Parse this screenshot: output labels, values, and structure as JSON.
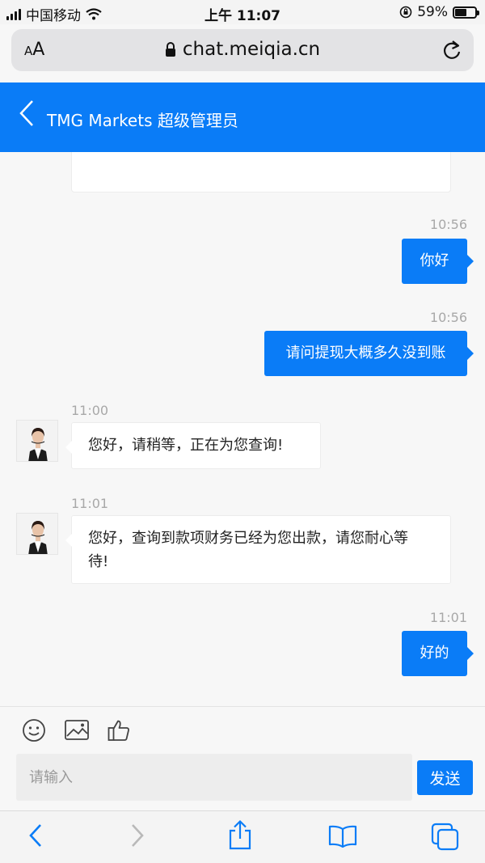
{
  "status_bar": {
    "carrier": "中国移动",
    "time": "上午 11:07",
    "battery_percent": "59%",
    "battery_level": 0.59
  },
  "browser": {
    "text_size_label_small": "A",
    "text_size_label_large": "A",
    "url": "chat.meiqia.cn"
  },
  "header": {
    "title": "TMG Markets 超级管理员"
  },
  "messages": [
    {
      "direction": "out",
      "time": "10:56",
      "text": "你好"
    },
    {
      "direction": "out",
      "time": "10:56",
      "text": "请问提现大概多久没到账"
    },
    {
      "direction": "in",
      "time": "11:00",
      "text": "您好，请稍等，正在为您查询!"
    },
    {
      "direction": "in",
      "time": "11:01",
      "text_line1": "您好，查询到款项财务已经为您出款，请您耐心等",
      "text_line2": "待!"
    },
    {
      "direction": "out",
      "time": "11:01",
      "text": "好的"
    }
  ],
  "composer": {
    "placeholder": "请输入",
    "value": "",
    "send_label": "发送"
  },
  "icons": {
    "toolbar": [
      "emoji-icon",
      "image-icon",
      "thumbs-up-icon"
    ],
    "safari": [
      "back-icon",
      "forward-icon",
      "share-icon",
      "bookmarks-icon",
      "tabs-icon"
    ]
  },
  "colors": {
    "accent": "#0a7cf7",
    "background": "#f7f7f7"
  }
}
